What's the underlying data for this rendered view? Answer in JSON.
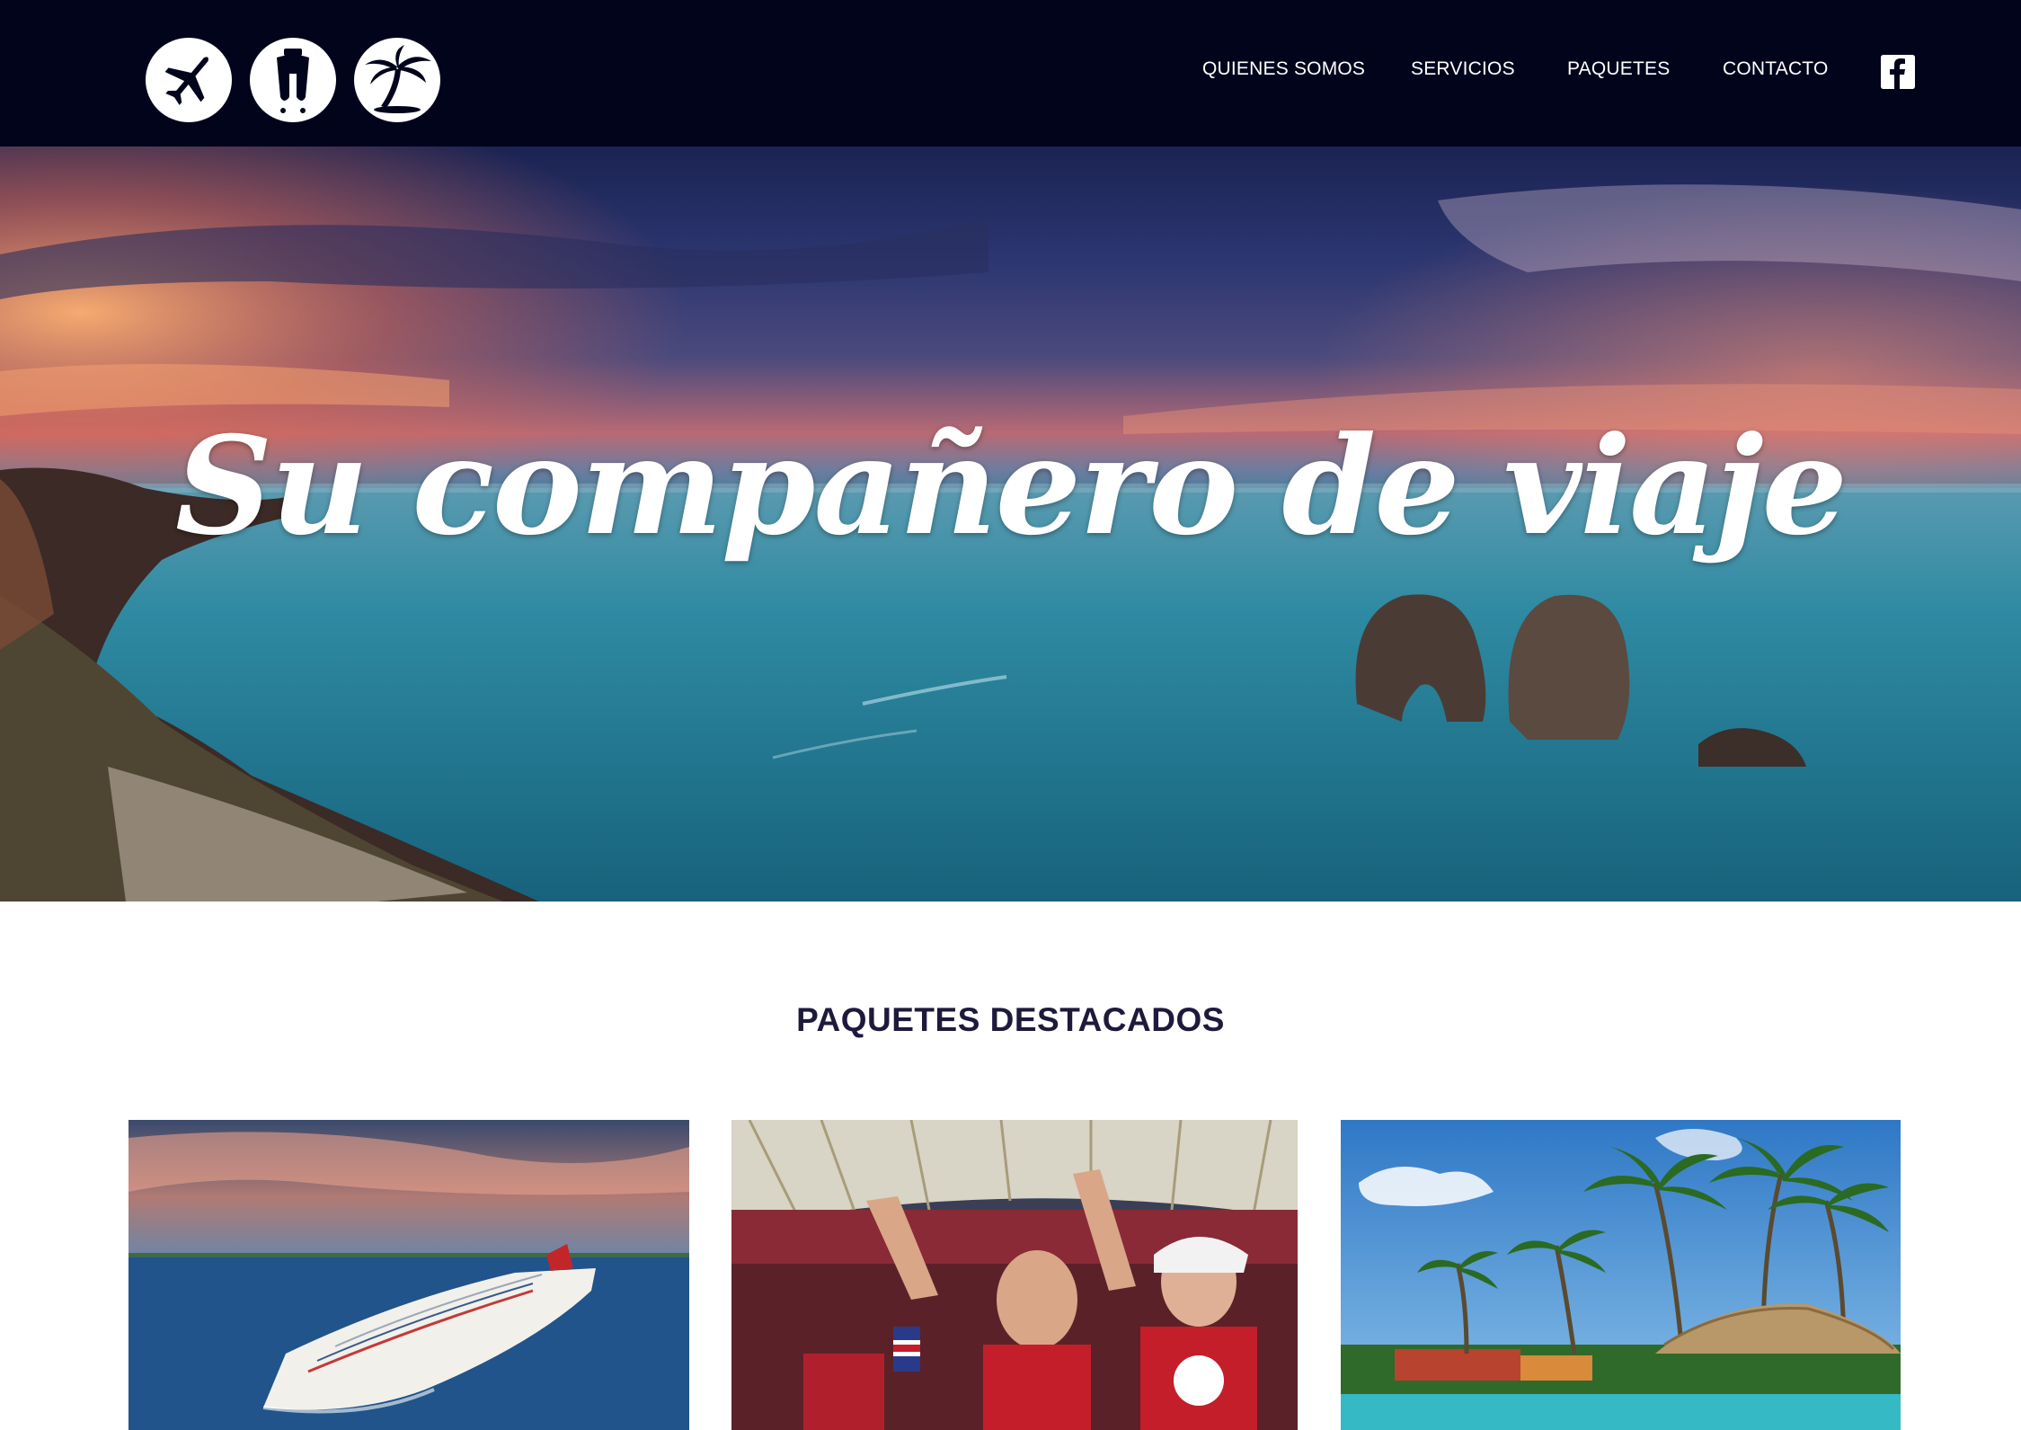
{
  "header": {
    "logo_icons": [
      "airplane-icon",
      "luggage-icon",
      "palm-tree-icon"
    ],
    "nav": [
      {
        "label": "QUIENES SOMOS"
      },
      {
        "label": "SERVICIOS"
      },
      {
        "label": "PAQUETES"
      },
      {
        "label": "CONTACTO"
      }
    ],
    "social_icon": "facebook-icon",
    "background_color": "#02041c"
  },
  "hero": {
    "title": "Su compañero de viaje"
  },
  "featured": {
    "title": "PAQUETES DESTACADOS",
    "cards": [
      {
        "image": "cruise-ship-photo"
      },
      {
        "image": "soccer-fans-photo"
      },
      {
        "image": "tropical-resort-photo"
      }
    ]
  },
  "colors": {
    "header_bg": "#02041c",
    "section_title": "#1e1a3c"
  }
}
